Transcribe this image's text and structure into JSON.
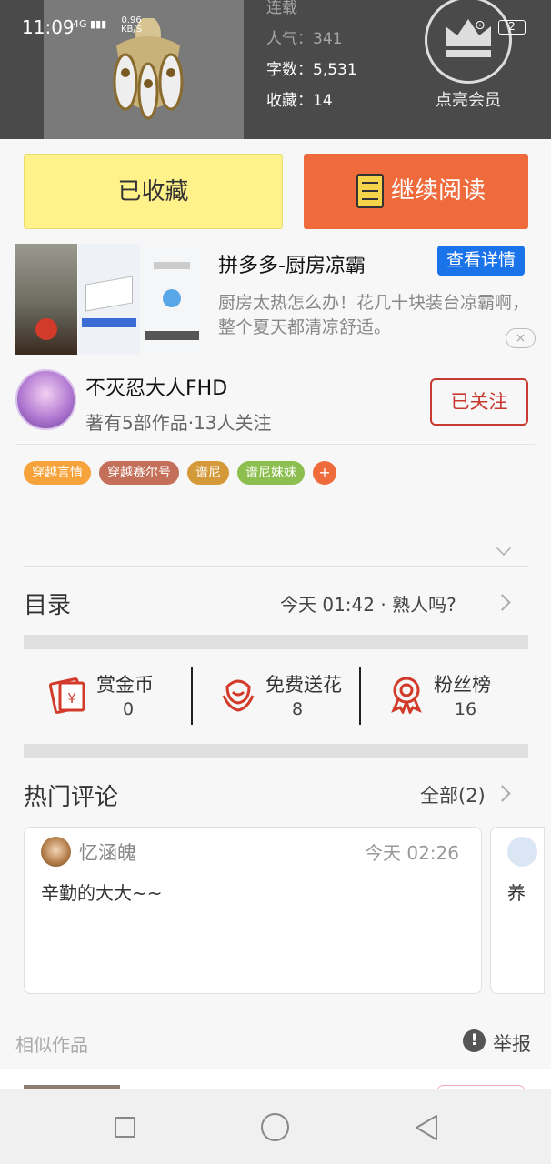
{
  "status_bar": {
    "time": "11:09",
    "signal": "4G",
    "net_speed": "0.96",
    "net_unit": "KB/S",
    "battery": "2"
  },
  "book": {
    "status": "连载",
    "popularity_label": "人气：",
    "popularity": "341",
    "words_label": "字数：",
    "words": "5,531",
    "favorites_label": "收藏：",
    "favorites": "14"
  },
  "member": {
    "label": "点亮会员",
    "icon": "crown-icon"
  },
  "buttons": {
    "collected": "已收藏",
    "continue_reading": "继续阅读"
  },
  "ad": {
    "title": "拼多多-厨房凉霸",
    "detail_button": "查看详情",
    "description": "厨房太热怎么办！花几十块装台凉霸啊，整个夏天都清凉舒适。",
    "close_icon": "×"
  },
  "author": {
    "name": "不灭忍大人FHD",
    "meta": "著有5部作品·13人关注",
    "follow_button": "已关注"
  },
  "tags": [
    {
      "label": "穿越言情",
      "color": "#f5a33a"
    },
    {
      "label": "穿越赛尔号",
      "color": "#c46f5a"
    },
    {
      "label": "谱尼",
      "color": "#d49a3a"
    },
    {
      "label": "谱尼妹妹",
      "color": "#8cbf4f"
    }
  ],
  "tag_plus": "+",
  "catalog": {
    "title": "目录",
    "latest": "今天 01:42 · 熟人吗?"
  },
  "actions": [
    {
      "label": "赏金币",
      "count": "0",
      "icon": "red-envelope-icon"
    },
    {
      "label": "免费送花",
      "count": "8",
      "icon": "flower-icon"
    },
    {
      "label": "粉丝榜",
      "count": "16",
      "icon": "medal-icon"
    }
  ],
  "hot_comments": {
    "title": "热门评论",
    "all_label": "全部(2)",
    "items": [
      {
        "user": "忆涵魄",
        "time": "今天 02:26",
        "text": "辛勤的大大~~"
      },
      {
        "user": "",
        "time": "",
        "text": "养"
      }
    ]
  },
  "similar": {
    "title": "相似作品",
    "report": "举报",
    "report_icon": "!"
  },
  "colors": {
    "accent_orange": "#ef6b3c",
    "collected_yellow": "#fff28a",
    "follow_red": "#c8392f",
    "ad_blue": "#1a73e8"
  }
}
